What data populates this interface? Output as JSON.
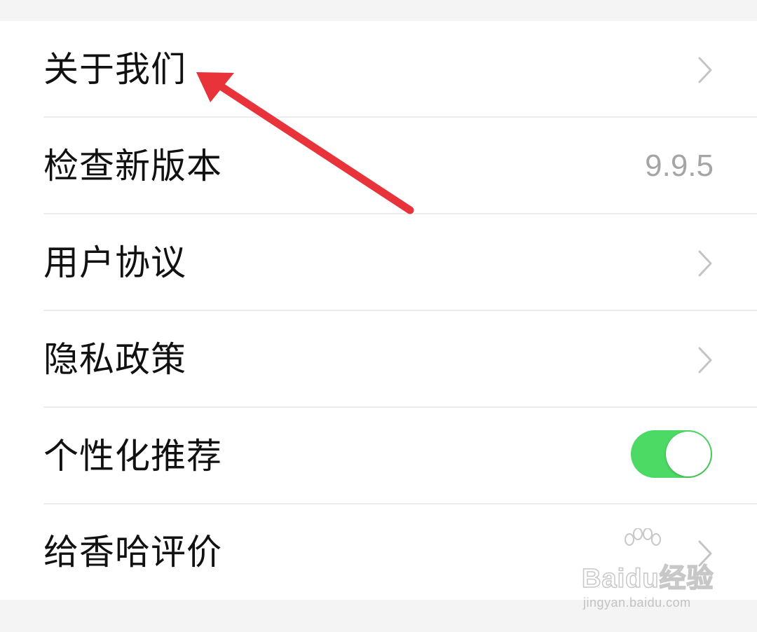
{
  "settings": {
    "items": [
      {
        "label": "关于我们",
        "trailing": "chevron"
      },
      {
        "label": "检查新版本",
        "trailing": "value",
        "value": "9.9.5"
      },
      {
        "label": "用户协议",
        "trailing": "chevron"
      },
      {
        "label": "隐私政策",
        "trailing": "chevron"
      },
      {
        "label": "个性化推荐",
        "trailing": "toggle",
        "toggle_on": true
      },
      {
        "label": "给香哈评价",
        "trailing": "chevron"
      }
    ]
  },
  "watermark": {
    "brand": "Baidu经验",
    "url": "jingyan.baidu.com"
  },
  "colors": {
    "toggle_on": "#4cd964",
    "annotation_arrow": "#e8333a",
    "secondary_text": "#a5a5a5"
  },
  "icons": [
    "chevron-right-icon",
    "annotation-arrow-icon",
    "baidu-paw-icon"
  ]
}
